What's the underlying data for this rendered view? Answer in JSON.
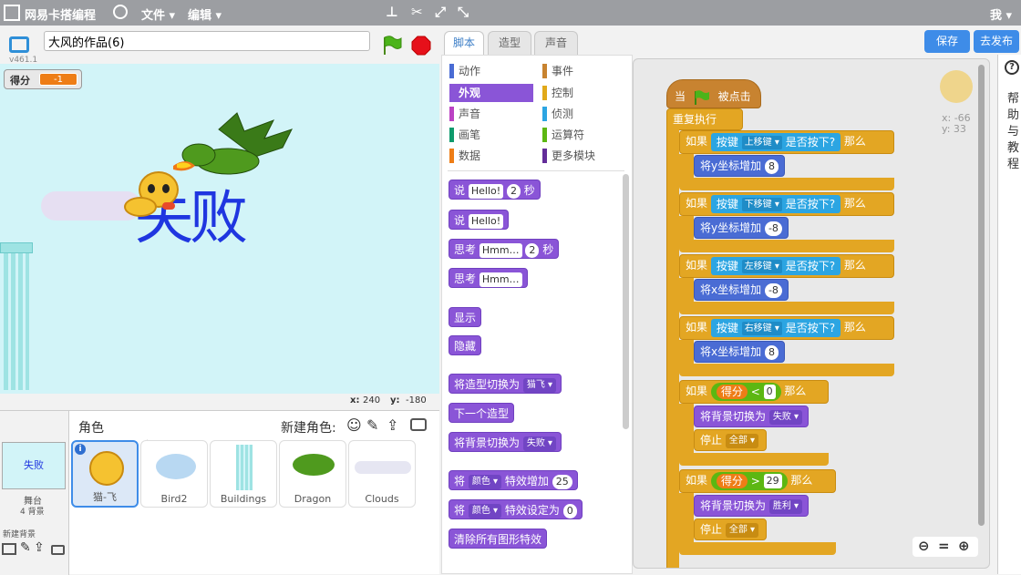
{
  "topbar": {
    "logo_text": "网易卡搭编程",
    "menu_file": "文件",
    "menu_edit": "编辑",
    "user": "我"
  },
  "stage": {
    "project_title": "大风的作品(6)",
    "version": "v461.1",
    "variable_label": "得分",
    "variable_value": "-1",
    "overlay_text": "失败",
    "x_label": "x:",
    "x_value": "240",
    "y_label": "y:",
    "y_value": "-180"
  },
  "sprites": {
    "header": "角色",
    "new_sprite": "新建角色:",
    "stage_label": "舞台",
    "stage_count": "4 背景",
    "stage_thumb_text": "失败",
    "new_backdrop": "新建背景",
    "items": [
      {
        "name": "猫-飞"
      },
      {
        "name": "Bird2"
      },
      {
        "name": "Buildings"
      },
      {
        "name": "Dragon"
      },
      {
        "name": "Clouds"
      }
    ]
  },
  "tabs": {
    "scripts": "脚本",
    "costumes": "造型",
    "sounds": "声音"
  },
  "buttons": {
    "save": "保存",
    "publish": "去发布"
  },
  "categories": [
    {
      "label": "动作",
      "color": "#4a6cd4"
    },
    {
      "label": "事件",
      "color": "#c88330"
    },
    {
      "label": "外观",
      "color": "#8a55d7"
    },
    {
      "label": "控制",
      "color": "#e1a91a"
    },
    {
      "label": "声音",
      "color": "#bb42c3"
    },
    {
      "label": "侦测",
      "color": "#2ca5e2"
    },
    {
      "label": "画笔",
      "color": "#0e9a6c"
    },
    {
      "label": "运算符",
      "color": "#5cb712"
    },
    {
      "label": "数据",
      "color": "#ee7d16"
    },
    {
      "label": "更多模块",
      "color": "#632d99"
    }
  ],
  "palette": {
    "say_secs": {
      "a": "说",
      "b": "Hello!",
      "c": "2",
      "d": "秒"
    },
    "say": {
      "a": "说",
      "b": "Hello!"
    },
    "think_secs": {
      "a": "思考",
      "b": "Hmm…",
      "c": "2",
      "d": "秒"
    },
    "think": {
      "a": "思考",
      "b": "Hmm…"
    },
    "show": "显示",
    "hide": "隐藏",
    "switch_costume": {
      "a": "将造型切换为",
      "b": "猫飞"
    },
    "next_costume": "下一个造型",
    "switch_backdrop": {
      "a": "将背景切换为",
      "b": "失败"
    },
    "change_effect": {
      "a": "将",
      "b": "颜色",
      "c": "特效增加",
      "d": "25"
    },
    "set_effect": {
      "a": "将",
      "b": "颜色",
      "c": "特效设定为",
      "d": "0"
    },
    "clear_effects": "清除所有图形特效"
  },
  "script": {
    "when": "当",
    "clicked": "被点击",
    "forever": "重复执行",
    "if": "如果",
    "then": "那么",
    "key": "按键",
    "pressed": "是否按下?",
    "k_up": "上移键",
    "k_down": "下移键",
    "k_left": "左移键",
    "k_right": "右移键",
    "change_y": "将y坐标增加",
    "change_x": "将x坐标增加",
    "v_8": "8",
    "v_m8": "-8",
    "score": "得分",
    "lt": "<",
    "gt": ">",
    "v_0": "0",
    "v_29": "29",
    "switch_bg": "将背景切换为",
    "fail": "失败",
    "win": "胜利",
    "stop": "停止",
    "all": "全部",
    "sprite_x": "x: -66",
    "sprite_y": "y: 33"
  },
  "help": {
    "q": "?",
    "text": "帮助与教程"
  }
}
